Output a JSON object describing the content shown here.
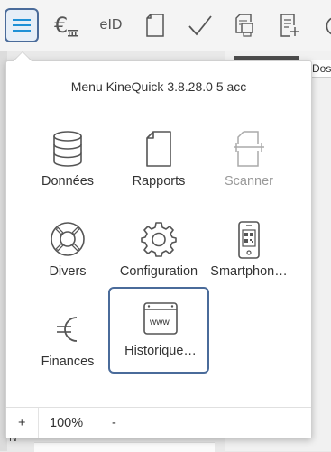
{
  "toolbar": {
    "buttons": [
      {
        "icon": "menu-icon",
        "active": true
      },
      {
        "icon": "euro-bank-icon"
      },
      {
        "icon": "eid-icon",
        "text": "eID"
      },
      {
        "icon": "document-icon"
      },
      {
        "icon": "checkmark-icon"
      },
      {
        "icon": "print-document-icon"
      },
      {
        "icon": "form-document-icon"
      },
      {
        "icon": "partial-icon"
      }
    ]
  },
  "background": {
    "doc_tab_label": "Dos",
    "bottom_letter": "N"
  },
  "menu": {
    "title": "Menu KineQuick 3.8.28.0 5 acc",
    "items": [
      {
        "label": "Données",
        "icon": "database-icon",
        "enabled": true
      },
      {
        "label": "Rapports",
        "icon": "report-document-icon",
        "enabled": true
      },
      {
        "label": "Scanner",
        "icon": "scanner-icon",
        "enabled": false
      },
      {
        "label": "Divers",
        "icon": "lifebuoy-icon",
        "enabled": true
      },
      {
        "label": "Configuration",
        "icon": "gear-icon",
        "enabled": true
      },
      {
        "label": "Smartphon…",
        "icon": "smartphone-icon",
        "enabled": true
      },
      {
        "label": "Finances",
        "icon": "euro-icon",
        "enabled": true
      },
      {
        "label": "Historique…",
        "icon": "history-browser-icon",
        "enabled": true,
        "selected": true,
        "icon_text": "www."
      }
    ],
    "footer": {
      "zoom_in": "+",
      "zoom_level": "100%",
      "zoom_out": "-"
    }
  },
  "colors": {
    "accent": "#4a6b9a",
    "menu_icon_blue": "#1e90d6",
    "icon_gray": "#555555",
    "disabled_gray": "#9a9a9a"
  }
}
